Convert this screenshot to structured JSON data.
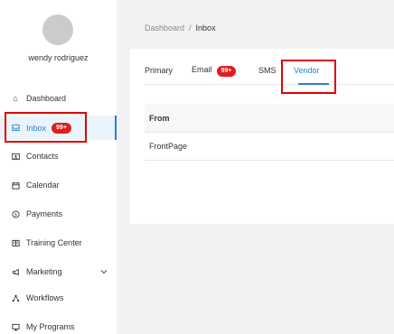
{
  "user": {
    "name": "wendy rodriguez"
  },
  "sidebar": {
    "items": [
      {
        "label": "Dashboard",
        "icon": "home-icon"
      },
      {
        "label": "Inbox",
        "icon": "inbox-icon",
        "badge": "99+",
        "active": true
      },
      {
        "label": "Contacts",
        "icon": "contacts-icon"
      },
      {
        "label": "Calendar",
        "icon": "calendar-icon"
      },
      {
        "label": "Payments",
        "icon": "payments-icon"
      },
      {
        "label": "Training Center",
        "icon": "training-icon"
      },
      {
        "label": "Marketing",
        "icon": "megaphone-icon",
        "expandable": true
      },
      {
        "label": "Workflows",
        "icon": "workflow-icon"
      },
      {
        "label": "My Programs",
        "icon": "monitor-icon"
      }
    ]
  },
  "breadcrumb": {
    "root": "Dashboard",
    "separator": "/",
    "current": "Inbox"
  },
  "tabs": [
    {
      "label": "Primary"
    },
    {
      "label": "Email",
      "badge": "99+"
    },
    {
      "label": "SMS"
    },
    {
      "label": "Vendor",
      "active": true
    }
  ],
  "table": {
    "header": "From",
    "rows": [
      "FrontPage"
    ]
  },
  "colors": {
    "accent": "#2a7fd3",
    "badge": "#e31d1d",
    "highlight": "#e00000"
  }
}
